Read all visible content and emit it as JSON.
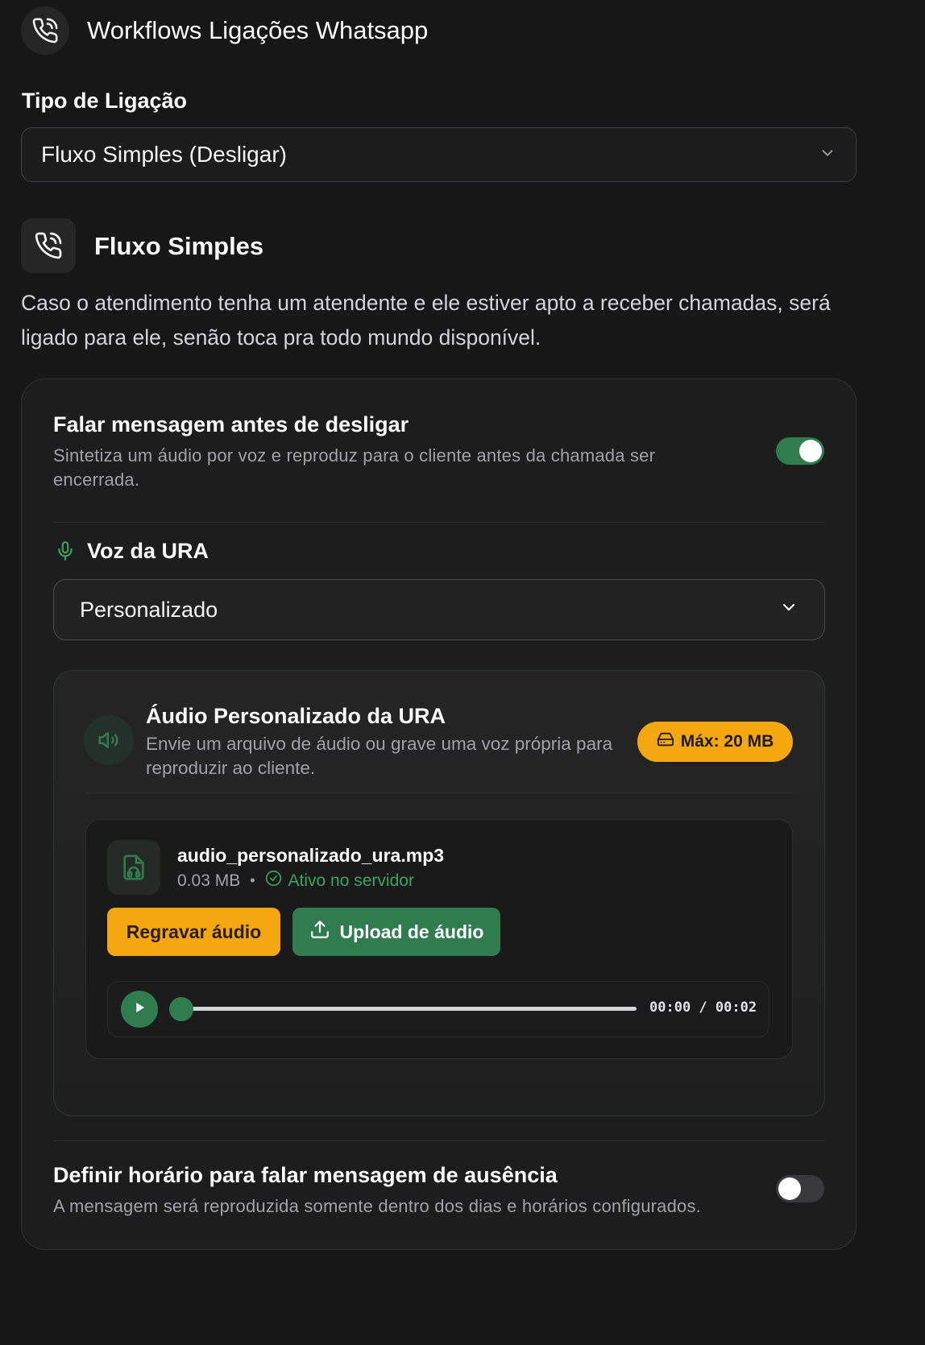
{
  "header": {
    "title": "Workflows Ligações Whatsapp",
    "icon": "phone-call-icon"
  },
  "call_type": {
    "label": "Tipo de Ligação",
    "selected": "Fluxo Simples (Desligar)"
  },
  "flow": {
    "icon": "phone-call-icon",
    "title": "Fluxo Simples",
    "description": "Caso o atendimento tenha um atendente e ele estiver apto a receber chamadas, será ligado para ele, senão toca pra todo mundo disponível."
  },
  "speak_before_hangup": {
    "title": "Falar mensagem antes de desligar",
    "description": "Sintetiza um áudio por voz e reproduz para o cliente antes da chamada ser encerrada.",
    "enabled": true
  },
  "ura_voice": {
    "label": "Voz da URA",
    "icon": "microphone-icon",
    "selected": "Personalizado"
  },
  "custom_audio": {
    "title": "Áudio Personalizado da URA",
    "description": "Envie um arquivo de áudio ou grave uma voz própria para reproduzir ao cliente.",
    "max_badge": "Máx: 20 MB",
    "file": {
      "name": "audio_personalizado_ura.mp3",
      "size": "0.03 MB",
      "separator": "•",
      "status": "Ativo no servidor"
    },
    "rerecord_label": "Regravar áudio",
    "upload_label": "Upload de áudio",
    "player": {
      "time": "00:00 / 00:02",
      "progress": 0
    }
  },
  "absence_schedule": {
    "title": "Definir horário para falar mensagem de ausência",
    "description": "A mensagem será reproduzida somente dentro dos dias e horários configurados.",
    "enabled": false
  },
  "colors": {
    "accent_green": "#2f7d4f",
    "accent_orange": "#f5a70f",
    "background": "#171717"
  }
}
